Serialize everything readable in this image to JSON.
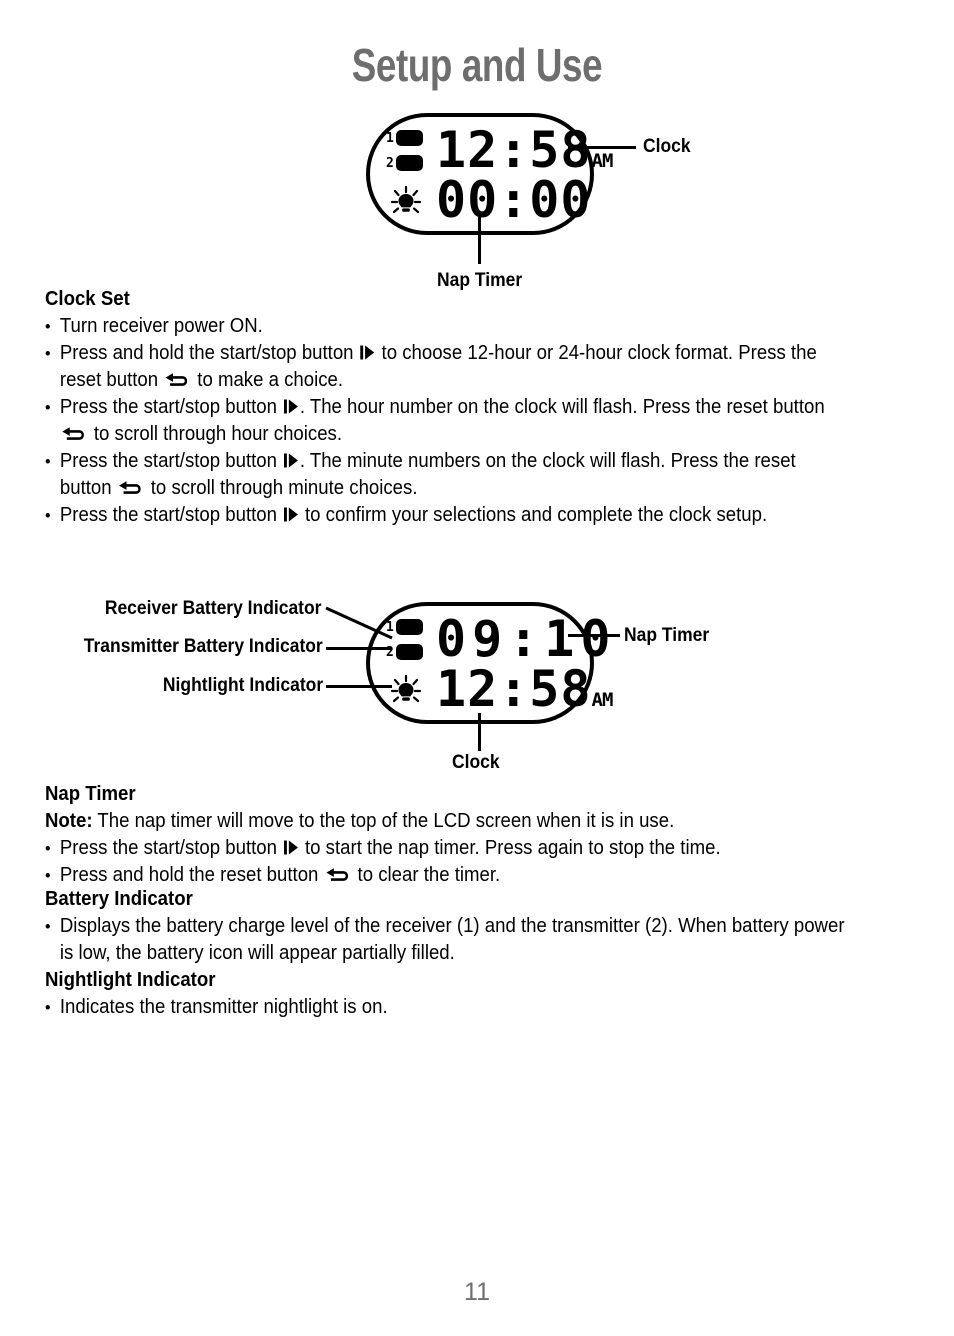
{
  "document": {
    "title": "Setup and Use",
    "page_number": "11"
  },
  "figure_1": {
    "lcd": {
      "battery_1_label": "1",
      "battery_2_label": "2",
      "top_row_value": "12:58",
      "top_row_meridiem": "AM",
      "bottom_row_value": "00:00"
    },
    "callouts": {
      "clock": "Clock",
      "nap_timer": "Nap Timer"
    }
  },
  "figure_2": {
    "lcd": {
      "battery_1_label": "1",
      "battery_2_label": "2",
      "top_row_value": "09:10",
      "bottom_row_value": "12:58",
      "bottom_row_meridiem": "AM"
    },
    "callouts": {
      "receiver_battery": "Receiver Battery Indicator",
      "transmitter_battery": "Transmitter Battery Indicator",
      "nightlight": "Nightlight Indicator",
      "nap_timer": "Nap Timer",
      "clock": "Clock"
    }
  },
  "sections": {
    "clock_set": {
      "heading": "Clock Set",
      "bullets": [
        {
          "parts": [
            {
              "type": "text",
              "value": "Turn receiver power ON."
            }
          ]
        },
        {
          "parts": [
            {
              "type": "text",
              "value": "Press and hold the start/stop button "
            },
            {
              "type": "icon",
              "value": "start-stop-icon"
            },
            {
              "type": "text",
              "value": " to choose 12-hour or 24-hour clock format. Press the reset button "
            },
            {
              "type": "icon",
              "value": "reset-icon"
            },
            {
              "type": "text",
              "value": " to make a choice."
            }
          ]
        },
        {
          "parts": [
            {
              "type": "text",
              "value": "Press the start/stop button "
            },
            {
              "type": "icon",
              "value": "start-stop-icon"
            },
            {
              "type": "text",
              "value": ". The hour number on the clock will flash. Press the reset button "
            },
            {
              "type": "icon",
              "value": "reset-icon"
            },
            {
              "type": "text",
              "value": " to scroll through hour choices."
            }
          ]
        },
        {
          "parts": [
            {
              "type": "text",
              "value": "Press the start/stop button "
            },
            {
              "type": "icon",
              "value": "start-stop-icon"
            },
            {
              "type": "text",
              "value": ". The minute numbers on the clock will flash. Press the reset button "
            },
            {
              "type": "icon",
              "value": "reset-icon"
            },
            {
              "type": "text",
              "value": " to scroll through minute choices."
            }
          ]
        },
        {
          "parts": [
            {
              "type": "text",
              "value": "Press the start/stop button "
            },
            {
              "type": "icon",
              "value": "start-stop-icon"
            },
            {
              "type": "text",
              "value": " to confirm your selections and complete the clock setup."
            }
          ]
        }
      ]
    },
    "nap_timer": {
      "heading": "Nap Timer",
      "note_label": "Note:",
      "note_text": " The nap timer will move to the top of the LCD screen when it is in use.",
      "bullets": [
        {
          "parts": [
            {
              "type": "text",
              "value": "Press the start/stop button "
            },
            {
              "type": "icon",
              "value": "start-stop-icon"
            },
            {
              "type": "text",
              "value": " to start the nap timer.  Press again to stop the time."
            }
          ]
        },
        {
          "parts": [
            {
              "type": "text",
              "value": "Press and hold the reset button "
            },
            {
              "type": "icon",
              "value": "reset-icon"
            },
            {
              "type": "text",
              "value": " to clear the timer."
            }
          ]
        }
      ]
    },
    "battery_indicator": {
      "heading": "Battery Indicator",
      "bullets": [
        {
          "parts": [
            {
              "type": "text",
              "value": "Displays the battery charge level of the receiver (1) and the transmitter (2). When battery power is low, the battery icon will appear partially filled."
            }
          ]
        }
      ]
    },
    "nightlight_indicator": {
      "heading": "Nightlight Indicator",
      "bullets": [
        {
          "parts": [
            {
              "type": "text",
              "value": "Indicates the transmitter nightlight is on."
            }
          ]
        }
      ]
    }
  },
  "colors": {
    "title_gray": "#6e6e6e",
    "text_black": "#000000",
    "page_background": "#ffffff"
  }
}
